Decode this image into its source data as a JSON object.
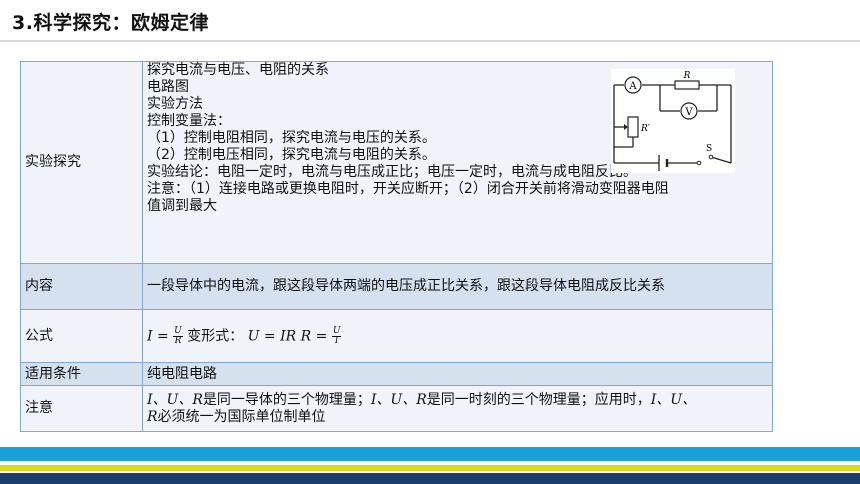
{
  "title": "3.科学探究：欧姆定律",
  "rows": {
    "experiment": {
      "label": "实验探究",
      "lines": [
        "探究电流与电压、电阻的关系",
        "电路图",
        "实验方法",
        "控制变量法：",
        "（1）控制电阻相同，探究电流与电压的关系。",
        "（2）控制电压相同，探究电流与电阻的关系。",
        "实验结论：电阻一定时，电流与电压成正比；电压一定时，电流与成电阻反比。",
        "注意：（1）连接电路或更换电阻时，开关应断开；（2）闭合开关前将滑动变阻器电阻",
        "值调到最大"
      ],
      "circuit": {
        "ammeter": "A",
        "voltmeter": "V",
        "resistor": "R",
        "rheostat": "R′",
        "switch": "S"
      }
    },
    "content": {
      "label": "内容",
      "text": "一段导体中的电流，跟这段导体两端的电压成正比关系，跟这段导体电阻成反比关系"
    },
    "formula": {
      "label": "公式",
      "I": "I",
      "eq": "=",
      "U": "U",
      "R": "R",
      "variant_label": "变形式：",
      "variant1": "U = IR",
      "variant2_R": "R",
      "variant2_eq": "=",
      "variant2_num": "U",
      "variant2_den": "I"
    },
    "condition": {
      "label": "适用条件",
      "text": "纯电阻电路"
    },
    "note": {
      "label": "注意",
      "line1_vars": "I、U、R",
      "line1_mid": "是同一导体的三个物理量；",
      "line1_vars2": "I、U、R",
      "line1_end": "是同一时刻的三个物理量；应用时，",
      "line1_vars3": "I、U、",
      "line2_var": "R",
      "line2_end": "必须统一为国际单位制单位"
    }
  }
}
